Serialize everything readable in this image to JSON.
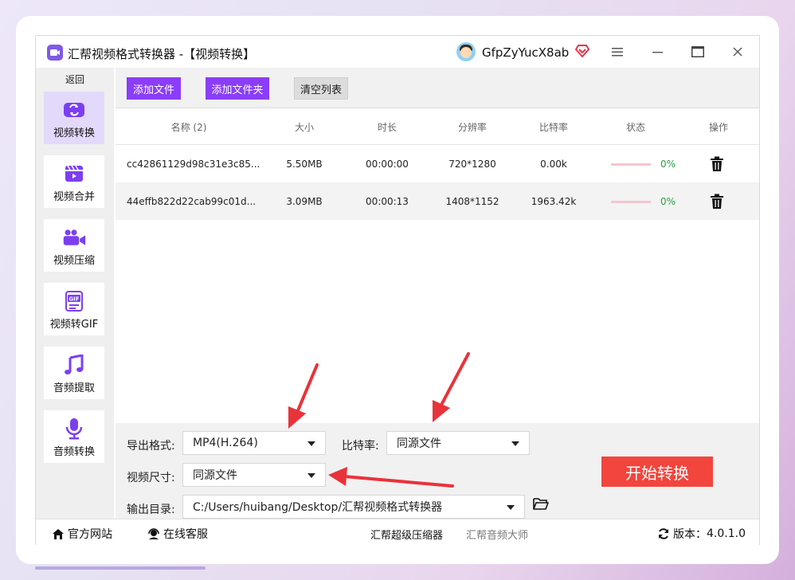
{
  "app": {
    "title": "汇帮视频格式转换器 -【视频转换】",
    "username": "GfpZyYucX8ab",
    "logo_icon": "video-app-logo-icon",
    "accent_color": "#8a3dfa"
  },
  "window_controls": {
    "menu_icon": "hamburger-menu-icon",
    "minimize_icon": "minimize-icon",
    "maximize_icon": "maximize-icon",
    "close_icon": "close-icon"
  },
  "sidebar": {
    "back_label": "返回",
    "items": [
      {
        "label": "视频转换",
        "icon": "video-convert-icon",
        "active": true
      },
      {
        "label": "视频合并",
        "icon": "video-merge-icon",
        "active": false
      },
      {
        "label": "视频压缩",
        "icon": "video-compress-icon",
        "active": false
      },
      {
        "label": "视频转GIF",
        "icon": "gif-icon",
        "active": false
      },
      {
        "label": "音频提取",
        "icon": "music-note-icon",
        "active": false
      },
      {
        "label": "音频转换",
        "icon": "microphone-icon",
        "active": false
      }
    ]
  },
  "toolbar": {
    "add_file_label": "添加文件",
    "add_folder_label": "添加文件夹",
    "clear_list_label": "清空列表"
  },
  "table": {
    "headers": [
      "名称 (2)",
      "大小",
      "时长",
      "分辨率",
      "比特率",
      "状态",
      "操作"
    ],
    "rows": [
      {
        "name": "cc42861129d98c31e3c85...",
        "size": "5.50MB",
        "duration": "00:00:00",
        "resolution": "720*1280",
        "bitrate": "0.00k",
        "progress": 0,
        "progress_label": "0%"
      },
      {
        "name": "44effb822d22cab99c01d...",
        "size": "3.09MB",
        "duration": "00:00:13",
        "resolution": "1408*1152",
        "bitrate": "1963.42k",
        "progress": 0,
        "progress_label": "0%"
      }
    ]
  },
  "settings": {
    "format_label": "导出格式:",
    "format_value": "MP4(H.264)",
    "bitrate_label": "比特率:",
    "bitrate_value": "同源文件",
    "size_label": "视频尺寸:",
    "size_value": "同源文件",
    "output_label": "输出目录:",
    "output_value": "C:/Users/huibang/Desktop/汇帮视频格式转换器",
    "start_label": "开始转换",
    "start_color": "#f2453d"
  },
  "footer": {
    "website_label": "官方网站",
    "support_label": "在线客服",
    "compressor_label": "汇帮超级压缩器",
    "audio_master_label": "汇帮音频大师",
    "version_label": "版本：",
    "version_value": "4.0.1.0"
  }
}
